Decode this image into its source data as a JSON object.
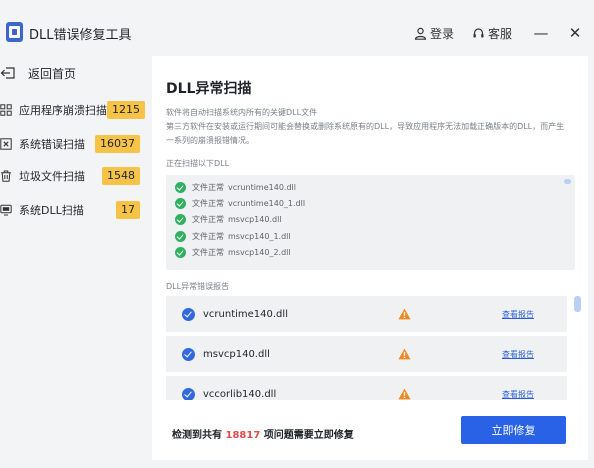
{
  "app": {
    "title": "DLL错误修复工具"
  },
  "titlebar": {
    "login_label": "登录",
    "service_label": "客服",
    "minimize_glyph": "—",
    "close_glyph": "✕"
  },
  "sidebar": {
    "back_label": "返回首页",
    "items": [
      {
        "label": "应用程序崩溃扫描",
        "count": "1215",
        "icon": "grid-icon"
      },
      {
        "label": "系统错误扫描",
        "count": "16037",
        "icon": "error-box-icon"
      },
      {
        "label": "垃圾文件扫描",
        "count": "1548",
        "icon": "trash-icon"
      },
      {
        "label": "系统DLL扫描",
        "count": "17",
        "icon": "dll-monitor-icon"
      }
    ]
  },
  "main": {
    "title": "DLL异常扫描",
    "desc1": "软件将自动扫描系统内所有的关键DLL文件",
    "desc2": "第三方软件在安装或运行期间可能会替换或删除系统原有的DLL，导致应用程序无法加载正确版本的DLL，而产生一系列的崩溃报错情况。",
    "scan_label": "正在扫描以下DLL",
    "scan_items": [
      {
        "status": "文件正常",
        "file": "vcruntime140.dll"
      },
      {
        "status": "文件正常",
        "file": "vcruntime140_1.dll"
      },
      {
        "status": "文件正常",
        "file": "msvcp140.dll"
      },
      {
        "status": "文件正常",
        "file": "msvcp140_1.dll"
      },
      {
        "status": "文件正常",
        "file": "msvcp140_2.dll"
      }
    ],
    "report_label": "DLL异常错误报告",
    "report_items": [
      {
        "file": "vcruntime140.dll",
        "link": "查看报告"
      },
      {
        "file": "msvcp140.dll",
        "link": "查看报告"
      },
      {
        "file": "vccorlib140.dll",
        "link": "查看报告"
      }
    ],
    "summary_prefix": "检测到共有",
    "summary_count": "18817",
    "summary_suffix": "项问题需要立即修复",
    "fix_button": "立即修复"
  },
  "colors": {
    "accent": "#2962e6",
    "badge": "#f6c347",
    "ok": "#2fb160",
    "warn": "#f08a24",
    "alert_number": "#e04b4b"
  }
}
